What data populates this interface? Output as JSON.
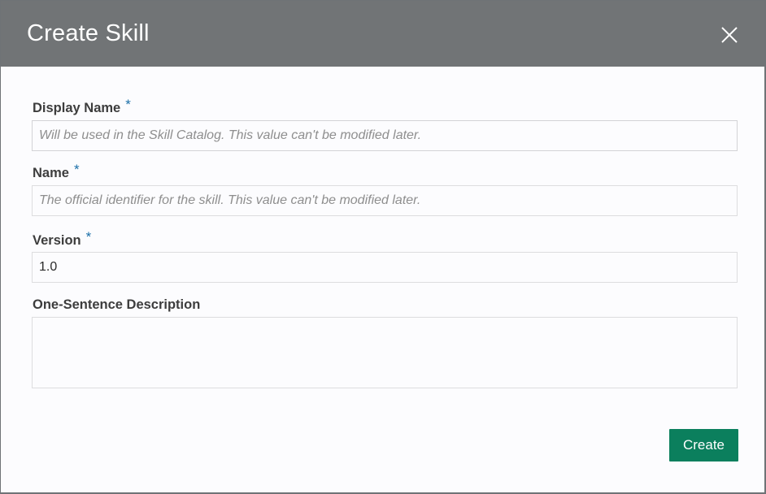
{
  "dialog": {
    "title": "Create Skill",
    "close_icon": "close-icon"
  },
  "form": {
    "display_name": {
      "label": "Display Name",
      "required_marker": "*",
      "value": "",
      "placeholder": "Will be used in the Skill Catalog. This value can't be modified later."
    },
    "name": {
      "label": "Name",
      "required_marker": "*",
      "value": "",
      "placeholder": "The official identifier for the skill. This value can't be modified later."
    },
    "version": {
      "label": "Version",
      "required_marker": "*",
      "value": "1.0",
      "placeholder": ""
    },
    "description": {
      "label": "One-Sentence Description",
      "value": "",
      "placeholder": ""
    }
  },
  "actions": {
    "create_label": "Create"
  },
  "colors": {
    "header_bg": "#717476",
    "primary_button": "#0b7f5d",
    "required_marker": "#1b6fa8"
  }
}
